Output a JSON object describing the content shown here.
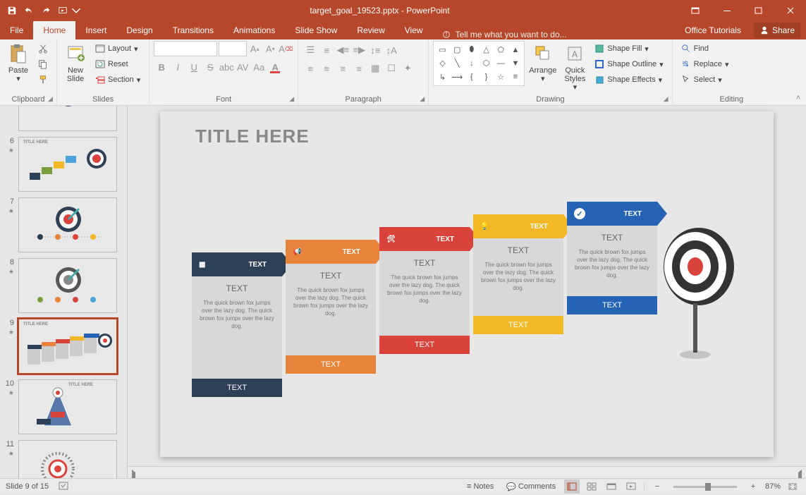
{
  "titlebar": {
    "filename": "target_goal_19523.pptx - PowerPoint"
  },
  "menu": {
    "file": "File",
    "tabs": [
      "Home",
      "Insert",
      "Design",
      "Transitions",
      "Animations",
      "Slide Show",
      "Review",
      "View"
    ],
    "tellme": "Tell me what you want to do...",
    "tutorials": "Office Tutorials",
    "share": "Share"
  },
  "ribbon": {
    "clipboard": {
      "label": "Clipboard",
      "paste": "Paste"
    },
    "slides": {
      "label": "Slides",
      "newslide": "New\nSlide",
      "layout": "Layout",
      "reset": "Reset",
      "section": "Section"
    },
    "font": {
      "label": "Font"
    },
    "paragraph": {
      "label": "Paragraph"
    },
    "drawing": {
      "label": "Drawing",
      "arrange": "Arrange",
      "quickstyles": "Quick\nStyles",
      "shapefill": "Shape Fill",
      "shapeoutline": "Shape Outline",
      "shapeeffects": "Shape Effects"
    },
    "editing": {
      "label": "Editing",
      "find": "Find",
      "replace": "Replace",
      "select": "Select"
    }
  },
  "thumbs": [
    {
      "num": "6",
      "title": "TITLE HERE"
    },
    {
      "num": "7",
      "title": ""
    },
    {
      "num": "8",
      "title": ""
    },
    {
      "num": "9",
      "title": "TITLE HERE",
      "selected": true
    },
    {
      "num": "10",
      "title": "TITLE HERE"
    },
    {
      "num": "11",
      "title": ""
    }
  ],
  "slide": {
    "title": "TITLE HERE",
    "steps": [
      {
        "arrow": "TEXT",
        "body_title": "TEXT",
        "desc": "The quick brown fox jumps over the lazy dog. The quick brown fox jumps over the lazy dog.",
        "footer": "TEXT"
      },
      {
        "arrow": "TEXT",
        "body_title": "TEXT",
        "desc": "The quick brown fox jumps over the lazy dog. The quick brown fox jumps over the lazy dog.",
        "footer": "TEXT"
      },
      {
        "arrow": "TEXT",
        "body_title": "TEXT",
        "desc": "The quick brown fox jumps over the lazy dog. The quick brown fox jumps over the lazy dog.",
        "footer": "TEXT"
      },
      {
        "arrow": "TEXT",
        "body_title": "TEXT",
        "desc": "The quick brown fox jumps over the lazy dog. The quick brown fox jumps over the lazy dog.",
        "footer": "TEXT"
      },
      {
        "arrow": "TEXT",
        "body_title": "TEXT",
        "desc": "The quick brown fox jumps over the lazy dog. The quick brown fox jumps over the lazy dog.",
        "footer": "TEXT"
      }
    ]
  },
  "status": {
    "slidecount": "Slide 9 of 15",
    "notes": "Notes",
    "comments": "Comments",
    "zoom": "87%"
  }
}
